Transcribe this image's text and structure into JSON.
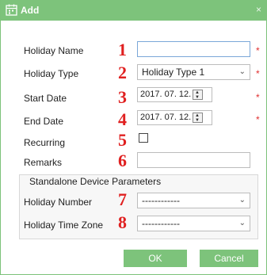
{
  "dialog": {
    "title": "Add",
    "close": "×"
  },
  "fields": {
    "holiday_name": {
      "label": "Holiday Name",
      "num": "1",
      "value": "",
      "required": "*"
    },
    "holiday_type": {
      "label": "Holiday Type",
      "num": "2",
      "value": "Holiday Type 1",
      "required": "*"
    },
    "start_date": {
      "label": "Start Date",
      "num": "3",
      "value": "2017. 07. 12.",
      "required": "*"
    },
    "end_date": {
      "label": "End Date",
      "num": "4",
      "value": "2017. 07. 12.",
      "required": "*"
    },
    "recurring": {
      "label": "Recurring",
      "num": "5",
      "checked": false
    },
    "remarks": {
      "label": "Remarks",
      "num": "6",
      "value": ""
    }
  },
  "standalone": {
    "title": "Standalone Device Parameters",
    "holiday_number": {
      "label": "Holiday Number",
      "num": "7",
      "value": "------------"
    },
    "holiday_time_zone": {
      "label": "Holiday Time Zone",
      "num": "8",
      "value": "------------"
    }
  },
  "buttons": {
    "ok": "OK",
    "cancel": "Cancel"
  },
  "colors": {
    "accent": "#7dc37b",
    "marker": "#e02020"
  }
}
